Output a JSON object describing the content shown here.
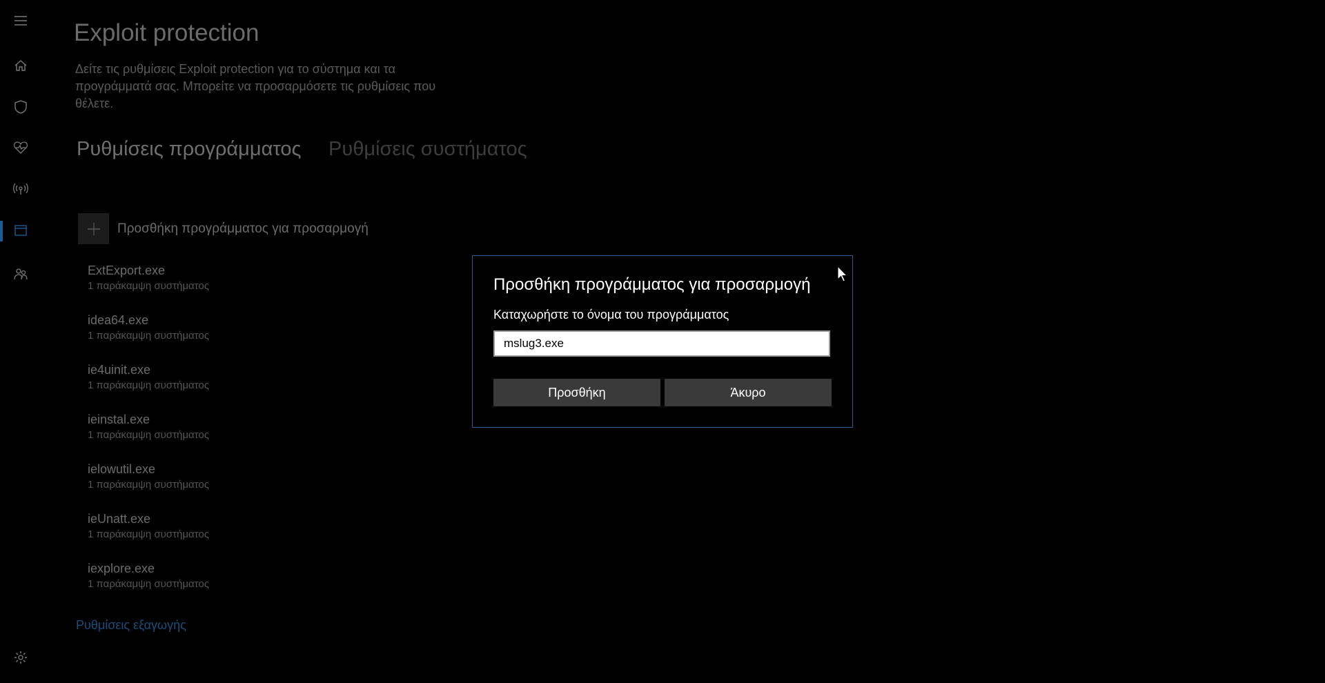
{
  "page": {
    "title": "Exploit protection",
    "description": "Δείτε τις ρυθμίσεις Exploit protection για το σύστημα και τα προγράμματά σας. Μπορείτε να προσαρμόσετε τις ρυθμίσεις που θέλετε."
  },
  "tabs": [
    {
      "label": "Ρυθμίσεις προγράμματος",
      "active": true
    },
    {
      "label": "Ρυθμίσεις συστήματος",
      "active": false
    }
  ],
  "add_program": {
    "label": "Προσθήκη προγράμματος για προσαρμογή"
  },
  "programs": [
    {
      "name": "ExtExport.exe",
      "sub": "1 παράκαμψη συστήματος"
    },
    {
      "name": "idea64.exe",
      "sub": "1 παράκαμψη συστήματος"
    },
    {
      "name": "ie4uinit.exe",
      "sub": "1 παράκαμψη συστήματος"
    },
    {
      "name": "ieinstal.exe",
      "sub": "1 παράκαμψη συστήματος"
    },
    {
      "name": "ielowutil.exe",
      "sub": "1 παράκαμψη συστήματος"
    },
    {
      "name": "ieUnatt.exe",
      "sub": "1 παράκαμψη συστήματος"
    },
    {
      "name": "iexplore.exe",
      "sub": "1 παράκαμψη συστήματος"
    }
  ],
  "export_link": "Ρυθμίσεις εξαγωγής",
  "dialog": {
    "title": "Προσθήκη προγράμματος για προσαρμογή",
    "label": "Καταχωρήστε το όνομα του προγράμματος",
    "input_value": "mslug3.exe",
    "add_button": "Προσθήκη",
    "cancel_button": "Άκυρο"
  },
  "colors": {
    "accent": "#1d5b94",
    "dialog_border": "#2d5b8a"
  },
  "sidebar_icons": [
    "menu-icon",
    "home-icon",
    "shield-icon",
    "heart-icon",
    "antenna-icon",
    "app-browser-icon",
    "family-icon",
    "gear-icon"
  ]
}
